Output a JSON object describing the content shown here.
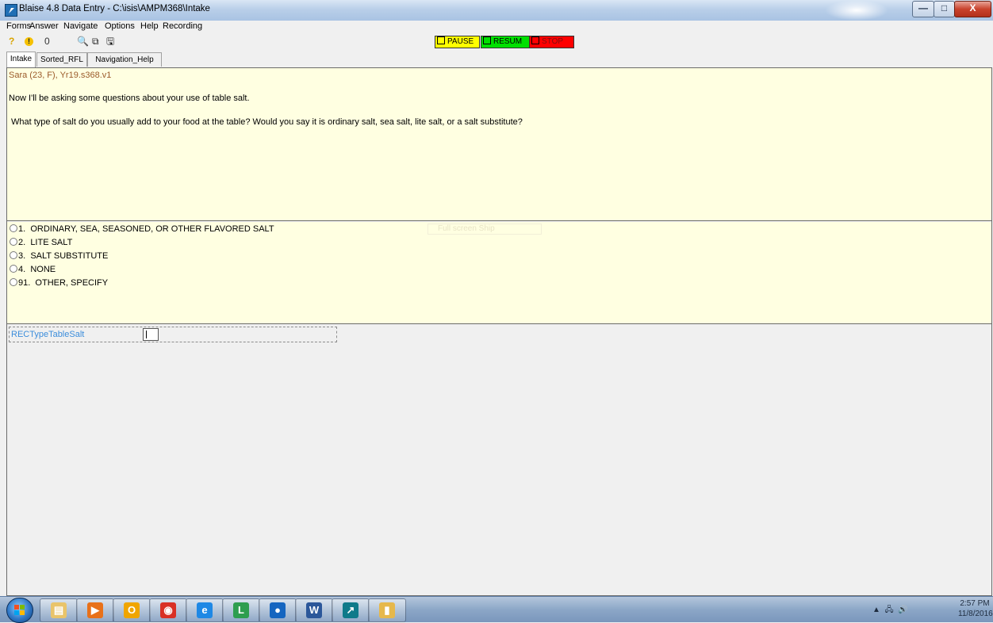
{
  "window": {
    "title": "Blaise 4.8 Data Entry - C:\\isis\\AMPM368\\Intake",
    "min_label": "—",
    "max_label": "□",
    "close_label": "X"
  },
  "menu": [
    "Forms",
    "Answer",
    "Navigate",
    "Options",
    "Help",
    "Recording"
  ],
  "toolbar": {
    "help_glyph": "?",
    "alert_glyph": "!",
    "attach_glyph": "0",
    "find_glyph": "🔍",
    "copy_glyph": "⧉",
    "save_glyph": "🖫"
  },
  "recording": {
    "pause_label": "PAUSE",
    "resume_label": "RESUM",
    "stop_label": "STOP",
    "pause_color": "#ffff00",
    "resume_color": "#00e000",
    "stop_color": "#ff0000"
  },
  "tabs": [
    "Intake",
    "Sorted_RFL",
    "Navigation_Help"
  ],
  "question": {
    "respondent": "Sara (23, F),  Yr19.s368.v1",
    "intro": "Now I'll be asking some questions about your use of table salt.",
    "text": "What type of salt do you usually add to your food at the table? Would you say it is ordinary salt, sea salt, lite salt, or a salt substitute?"
  },
  "answers": [
    {
      "code": "1.",
      "label": "ORDINARY, SEA, SEASONED, OR OTHER FLAVORED SALT"
    },
    {
      "code": "2.",
      "label": "LITE SALT"
    },
    {
      "code": "3.",
      "label": "SALT SUBSTITUTE"
    },
    {
      "code": "4.",
      "label": "NONE"
    },
    {
      "code": "91.",
      "label": "OTHER, SPECIFY"
    }
  ],
  "faint_overlay": "Full screen Ship",
  "field": {
    "name": "RECTypeTableSalt",
    "value": ""
  },
  "taskbar": {
    "apps": [
      {
        "icon": "file-explorer-icon",
        "color": "#e9c46a"
      },
      {
        "icon": "media-player-icon",
        "color": "#e8711a"
      },
      {
        "icon": "outlook-icon",
        "color": "#f0a500"
      },
      {
        "icon": "chrome-icon",
        "color": "#d93025"
      },
      {
        "icon": "internet-explorer-icon",
        "color": "#1e88e5"
      },
      {
        "icon": "lync-icon",
        "color": "#2e9e4f"
      },
      {
        "icon": "blue-red-app-icon",
        "color": "#1565c0"
      },
      {
        "icon": "word-icon",
        "color": "#2b579a"
      },
      {
        "icon": "blaise-icon",
        "color": "#0f7a8a"
      },
      {
        "icon": "folder-icon",
        "color": "#e6b84c"
      }
    ],
    "time": "2:57 PM",
    "date": "11/8/2016"
  }
}
